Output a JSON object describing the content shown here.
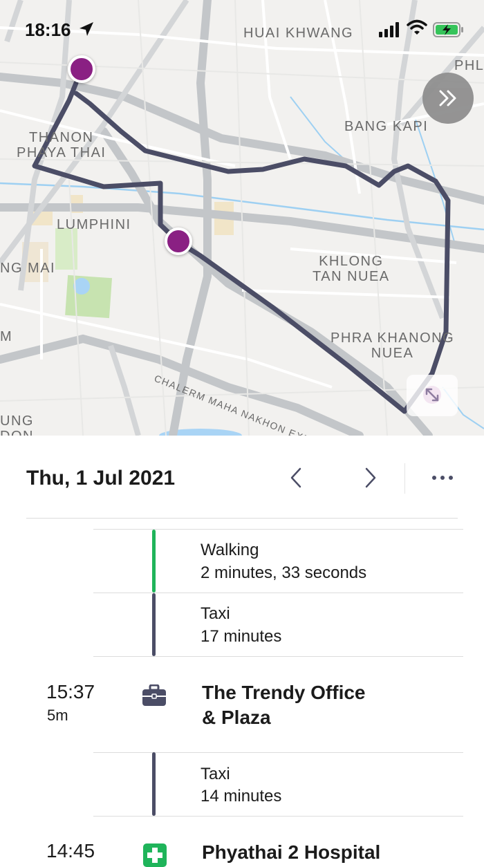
{
  "status_bar": {
    "time": "18:16",
    "icons": [
      "location-arrow-icon",
      "cellular-signal-icon",
      "wifi-icon",
      "battery-charging-icon"
    ]
  },
  "map": {
    "labels": [
      {
        "id": "huai_khwang",
        "text": "HUAI KHWANG"
      },
      {
        "id": "phl",
        "text": "PHL"
      },
      {
        "id": "bang_kapi",
        "text": "BANG KAPI"
      },
      {
        "id": "thanon_phaya_thai",
        "text": "THANON\nPHAYA THAI"
      },
      {
        "id": "lumphini",
        "text": "LUMPHINI"
      },
      {
        "id": "ng_mai",
        "text": "NG MAI"
      },
      {
        "id": "khlong_tan_nuea",
        "text": "KHLONG\nTAN NUEA"
      },
      {
        "id": "phra_khanong_nuea",
        "text": "PHRA KHANONG\nNUEA"
      },
      {
        "id": "m",
        "text": "M"
      },
      {
        "id": "ung_don",
        "text": "UNG\nDON"
      },
      {
        "id": "expressway",
        "text": "CHALERM MAHA NAKHON EXPRESS"
      }
    ],
    "colors": {
      "route": "#4b4d66",
      "pin": "#8a2083",
      "park": "#c7e3b0",
      "water": "#a9d4f5"
    }
  },
  "timeline": {
    "date": "Thu, 1 Jul 2021",
    "segments": [
      {
        "mode": "Walking",
        "duration": "2 minutes, 33 seconds",
        "color": "#1fb45a"
      },
      {
        "mode": "Taxi",
        "duration": "17 minutes",
        "color": "#4b4d66"
      },
      {
        "mode": "Taxi",
        "duration": "14 minutes",
        "color": "#4b4d66"
      }
    ],
    "visits": [
      {
        "time": "15:37",
        "duration": "5m",
        "name_line1": "The Trendy Office",
        "name_line2": "& Plaza",
        "icon": "briefcase-icon",
        "icon_color": "#4b4d66"
      },
      {
        "time": "14:45",
        "name_line1": "Phyathai 2 Hospital",
        "icon": "hospital-icon",
        "icon_color": "#1fb45a"
      }
    ]
  }
}
